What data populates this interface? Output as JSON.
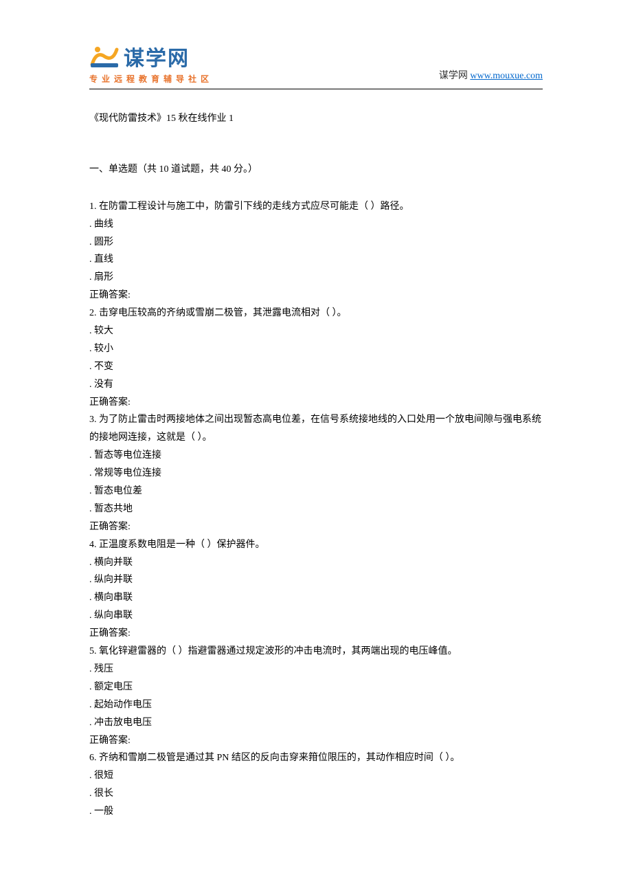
{
  "header": {
    "logo_main": "谋学网",
    "logo_sub": "www.mouxue.com",
    "logo_tagline": "专业远程教育辅导社区",
    "right_prefix": "谋学网 ",
    "right_link": "www.mouxue.com"
  },
  "doc": {
    "title": "《现代防雷技术》15 秋在线作业 1",
    "section1": "一、单选题（共 10 道试题，共 40 分。）",
    "questions": [
      {
        "q": "1.   在防雷工程设计与施工中，防雷引下线的走线方式应尽可能走（ ）路径。",
        "opts": [
          ". 曲线",
          ". 圆形",
          ". 直线",
          ". 扇形"
        ],
        "ans": "正确答案:"
      },
      {
        "q": "2.   击穿电压较高的齐纳或雪崩二极管，其泄露电流相对（ ）。",
        "opts": [
          ". 较大",
          ". 较小",
          ". 不变",
          ". 没有"
        ],
        "ans": "正确答案:"
      },
      {
        "q": "3.   为了防止雷击时两接地体之间出现暂态高电位差，在信号系统接地线的入口处用一个放电间隙与强电系统的接地网连接，这就是（ ）。",
        "opts": [
          ". 暂态等电位连接",
          ". 常规等电位连接",
          ". 暂态电位差",
          ". 暂态共地"
        ],
        "ans": "正确答案:"
      },
      {
        "q": "4.   正温度系数电阻是一种（ ）保护器件。",
        "opts": [
          ". 横向并联",
          ". 纵向并联",
          ". 横向串联",
          ". 纵向串联"
        ],
        "ans": "正确答案:"
      },
      {
        "q": "5.   氧化锌避雷器的（ ）指避雷器通过规定波形的冲击电流时，其两端出现的电压峰值。",
        "opts": [
          ". 残压",
          ". 额定电压",
          ". 起始动作电压",
          ". 冲击放电电压"
        ],
        "ans": "正确答案:"
      },
      {
        "q": "6.   齐纳和雪崩二极管是通过其 PN 结区的反向击穿来箝位限压的，其动作相应时间（ ）。",
        "opts": [
          ". 很短",
          ". 很长",
          ". 一般"
        ],
        "ans": ""
      }
    ]
  }
}
